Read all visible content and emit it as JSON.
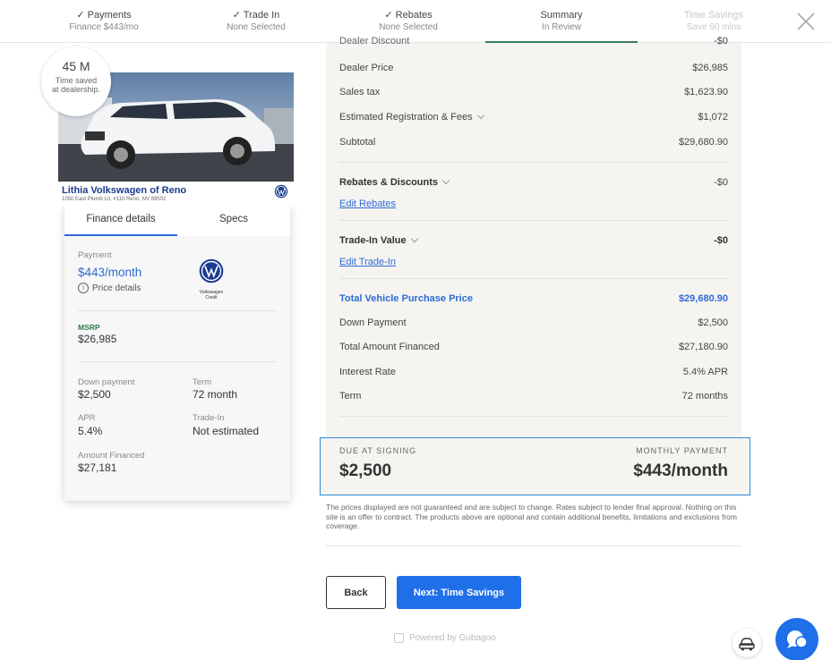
{
  "stepper": {
    "steps": [
      {
        "title": "✓ Payments",
        "sub": "Finance $443/mo"
      },
      {
        "title": "✓ Trade In",
        "sub": "None Selected"
      },
      {
        "title": "✓ Rebates",
        "sub": "None Selected"
      },
      {
        "title": "Summary",
        "sub": "In Review"
      },
      {
        "title": "Time Savings",
        "sub": "Save 60 mins"
      }
    ]
  },
  "badge": {
    "value": "45 M",
    "line1": "Time saved",
    "line2": "at dealership."
  },
  "dealer": {
    "name": "Lithia Volkswagen of Reno",
    "address": "1050 East Plumb Ln, #110 Reno, NV 89502"
  },
  "tabs": [
    "Finance details",
    "Specs"
  ],
  "finance": {
    "payment_label": "Payment",
    "payment_value": "$443/month",
    "price_details": "Price details",
    "lender_caption": "Volkswagen Credit",
    "msrp_label": "MSRP",
    "msrp_value": "$26,985",
    "down_label": "Down payment",
    "down_value": "$2,500",
    "term_label": "Term",
    "term_value": "72 month",
    "apr_label": "APR",
    "apr_value": "5.4%",
    "tradein_label": "Trade-In",
    "tradein_value": "Not estimated",
    "financed_label": "Amount Financed",
    "financed_value": "$27,181"
  },
  "summary": {
    "clipped_label": "Dealer Discount",
    "clipped_value": "-$0",
    "rows_top": [
      {
        "label": "Dealer Price",
        "value": "$26,985"
      },
      {
        "label": "Sales tax",
        "value": "$1,623.90"
      },
      {
        "label": "Estimated Registration & Fees",
        "value": "$1,072"
      },
      {
        "label": "Subtotal",
        "value": "$29,680.90"
      }
    ],
    "rebates_label": "Rebates & Discounts",
    "rebates_value": "-$0",
    "edit_rebates": "Edit Rebates",
    "tradein_label": "Trade-In Value",
    "tradein_value": "-$0",
    "edit_tradein": "Edit Trade-In",
    "total_label": "Total Vehicle Purchase Price",
    "total_value": "$29,680.90",
    "rows_bottom": [
      {
        "label": "Down Payment",
        "value": "$2,500"
      },
      {
        "label": "Total Amount Financed",
        "value": "$27,180.90"
      },
      {
        "label": "Interest Rate",
        "value": "5.4% APR"
      },
      {
        "label": "Term",
        "value": "72 months"
      }
    ]
  },
  "due": {
    "signing_label": "DUE AT SIGNING",
    "signing_value": "$2,500",
    "monthly_label": "MONTHLY PAYMENT",
    "monthly_value": "$443/month"
  },
  "disclaimer": "The prices displayed are not guaranteed and are subject to change. Rates subject to lender final approval. Nothing on this site is an offer to contract. The products above are optional and contain additional benefits, limitations and exclusions from coverage.",
  "buttons": {
    "back": "Back",
    "next": "Next: Time Savings"
  },
  "powered_by": "Powered by Gubagoo",
  "colors": {
    "accent": "#1f6fe8",
    "link": "#2d6bd6",
    "msrp": "#2e7d4e",
    "step_underline": "#3a7d5c"
  }
}
